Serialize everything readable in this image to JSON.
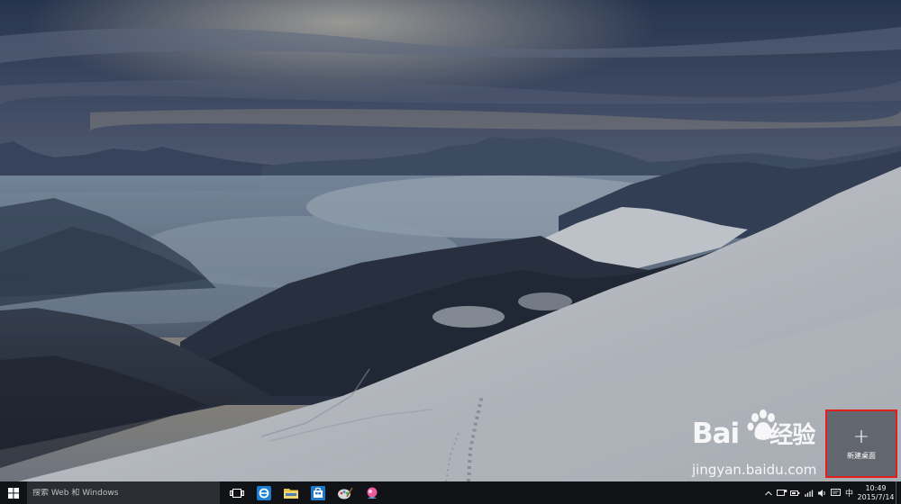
{
  "task_view": {
    "new_desktop_label": "新建桌面",
    "new_desktop_symbol": "+"
  },
  "watermark": {
    "logo_text_left": "Bai",
    "logo_text_right": "经验",
    "url": "jingyan.baidu.com"
  },
  "taskbar": {
    "search_placeholder": "搜索 Web 和 Windows",
    "apps": [
      "task-view-icon",
      "ie-icon",
      "file-explorer-icon",
      "store-icon",
      "app-icon-1",
      "app-icon-2"
    ],
    "tray": {
      "ime": "中",
      "time": "10:49",
      "date": "2015/7/14"
    }
  },
  "colors": {
    "highlight": "#e0201a",
    "taskbar": "#101216"
  }
}
